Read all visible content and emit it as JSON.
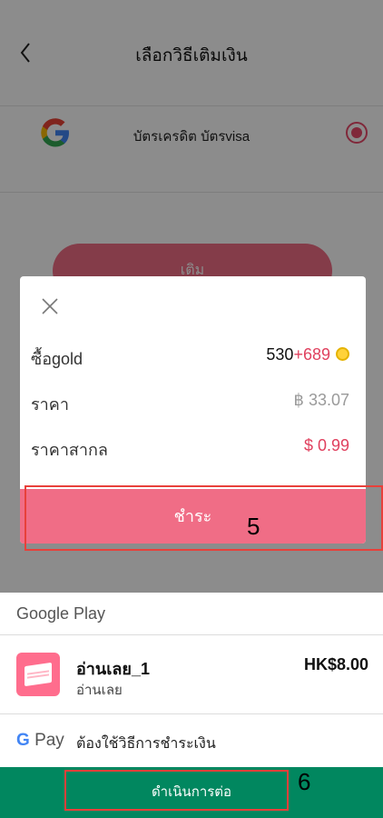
{
  "screen": {
    "title": "เลือกวิธีเติมเงิน",
    "payment_method_label": "บัตรเครดิต บัตรvisa",
    "topup_button": "เติม"
  },
  "dialog": {
    "rows": [
      {
        "label": "ซื้อgold",
        "value_base": "530",
        "value_bonus": "+689"
      },
      {
        "label": "ราคา",
        "value": "฿ 33.07"
      },
      {
        "label": "ราคาสากล",
        "value": "$ 0.99"
      }
    ],
    "pay_button": "ชำระ"
  },
  "google_play": {
    "header": "Google Play",
    "app_name": "อ่านเลย_1",
    "app_subtitle": "อ่านเลย",
    "price": "HK$8.00",
    "gpay_g": "G",
    "gpay_label": "Pay",
    "payment_method": "ต้องใช้วิธีการชำระเงิน",
    "continue_button": "ดำเนินการต่อ"
  },
  "annotations": [
    "5",
    "6"
  ],
  "colors": {
    "accent": "#f06d86",
    "bonus_red": "#e0405e",
    "play_green": "#01875f",
    "annotation_red": "#e8403a"
  },
  "icons": [
    "back-arrow-icon",
    "google-logo-icon",
    "close-icon",
    "gold-coin-icon",
    "app-icon"
  ]
}
